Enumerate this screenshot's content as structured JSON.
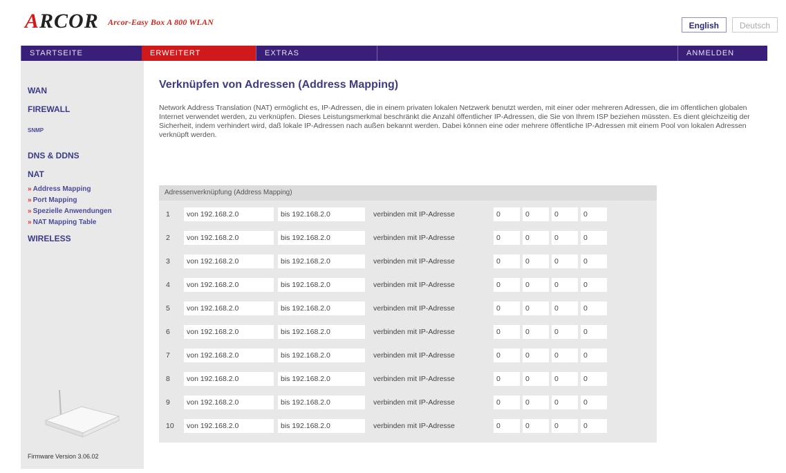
{
  "brand": {
    "logo_prefix": "A",
    "logo_rest": "RCOR",
    "tagline": "Arcor-Easy Box A 800 WLAN"
  },
  "language": {
    "english": "English",
    "deutsch": "Deutsch"
  },
  "nav": {
    "home": "STARTSEITE",
    "advanced": "ERWEITERT",
    "extras": "EXTRAS",
    "login": "ANMELDEN"
  },
  "sidebar": {
    "wan": "WAN",
    "firewall": "FIREWALL",
    "snmp": "SNMP",
    "dns": "DNS & DDNS",
    "nat": "NAT",
    "sub_items": [
      "Address Mapping",
      "Port Mapping",
      "Spezielle Anwendungen",
      "NAT Mapping Table"
    ],
    "wireless": "WIRELESS",
    "firmware": "Firmware Version 3.06.02"
  },
  "main": {
    "title": "Verknüpfen von Adressen (Address Mapping)",
    "intro": "Network Address Translation (NAT) ermöglicht es, IP-Adressen, die in einem privaten lokalen Netzwerk benutzt werden, mit einer oder mehreren Adressen, die im öffentlichen globalen Internet verwendet werden, zu verknüpfen. Dieses Leistungsmerkmal beschränkt die Anzahl öffentlicher IP-Adressen, die Sie von Ihrem ISP beziehen müssten. Es dient gleichzeitig der Sicherheit, indem verhindert wird, daß lokale IP-Adressen nach außen bekannt werden. Dabei können eine oder mehrere öffentliche IP-Adressen mit einem Pool von lokalen Adressen verknüpft werden.",
    "table_header": "Adressenverknüpfung (Address Mapping)",
    "connect_label": "verbinden mit IP-Adresse",
    "rows": [
      {
        "num": "1",
        "from": "von 192.168.2.0",
        "to": "bis 192.168.2.0",
        "ip": [
          "0",
          "0",
          "0",
          "0"
        ]
      },
      {
        "num": "2",
        "from": "von 192.168.2.0",
        "to": "bis 192.168.2.0",
        "ip": [
          "0",
          "0",
          "0",
          "0"
        ]
      },
      {
        "num": "3",
        "from": "von 192.168.2.0",
        "to": "bis 192.168.2.0",
        "ip": [
          "0",
          "0",
          "0",
          "0"
        ]
      },
      {
        "num": "4",
        "from": "von 192.168.2.0",
        "to": "bis 192.168.2.0",
        "ip": [
          "0",
          "0",
          "0",
          "0"
        ]
      },
      {
        "num": "5",
        "from": "von 192.168.2.0",
        "to": "bis 192.168.2.0",
        "ip": [
          "0",
          "0",
          "0",
          "0"
        ]
      },
      {
        "num": "6",
        "from": "von 192.168.2.0",
        "to": "bis 192.168.2.0",
        "ip": [
          "0",
          "0",
          "0",
          "0"
        ]
      },
      {
        "num": "7",
        "from": "von 192.168.2.0",
        "to": "bis 192.168.2.0",
        "ip": [
          "0",
          "0",
          "0",
          "0"
        ]
      },
      {
        "num": "8",
        "from": "von 192.168.2.0",
        "to": "bis 192.168.2.0",
        "ip": [
          "0",
          "0",
          "0",
          "0"
        ]
      },
      {
        "num": "9",
        "from": "von 192.168.2.0",
        "to": "bis 192.168.2.0",
        "ip": [
          "0",
          "0",
          "0",
          "0"
        ]
      },
      {
        "num": "10",
        "from": "von 192.168.2.0",
        "to": "bis 192.168.2.0",
        "ip": [
          "0",
          "0",
          "0",
          "0"
        ]
      }
    ]
  },
  "colors": {
    "nav_bg": "#3a1f78",
    "nav_active": "#d0191b",
    "sidebar_bg": "#e9e9e9",
    "link": "#3b3a88"
  }
}
